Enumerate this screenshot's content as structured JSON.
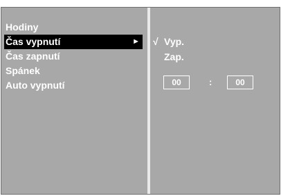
{
  "menu": {
    "items": [
      {
        "label": "Hodiny"
      },
      {
        "label": "Čas vypnutí"
      },
      {
        "label": "Čas zapnutí"
      },
      {
        "label": "Spánek"
      },
      {
        "label": "Auto vypnutí"
      }
    ],
    "selected_index": 1,
    "arrow_icon": "arrow-right-icon",
    "arrow_glyph": "►"
  },
  "submenu": {
    "options": [
      {
        "label": "Vyp.",
        "checked": true
      },
      {
        "label": "Zap.",
        "checked": false
      }
    ],
    "check_glyph": "√",
    "time": {
      "hour": "00",
      "separator": ":",
      "minute": "00"
    }
  },
  "colors": {
    "panel_bg": "#a8a8a8",
    "highlight_bg": "#000000",
    "text": "#ffffff",
    "divider": "#e9e9e9"
  }
}
